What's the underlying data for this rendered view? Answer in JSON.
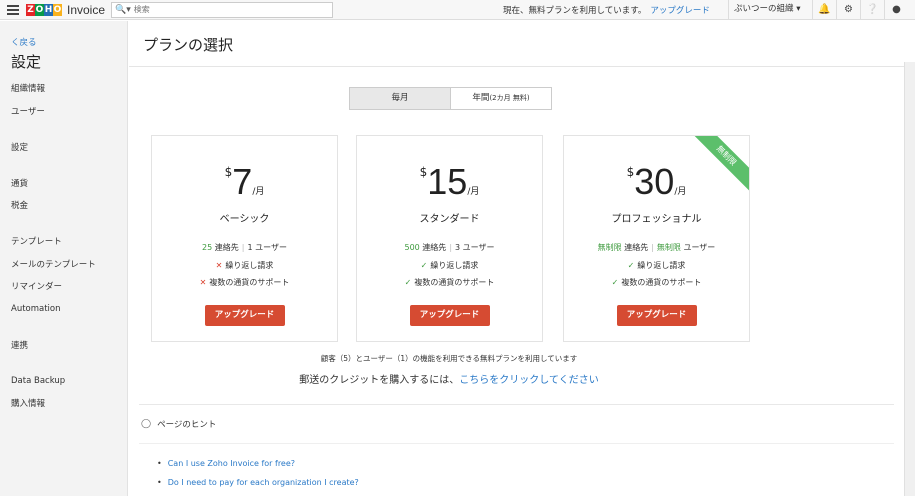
{
  "topbar": {
    "logo_letters": [
      "Z",
      "O",
      "H",
      "O"
    ],
    "logo_colors": [
      "#e42527",
      "#089949",
      "#226db4",
      "#f9b21d"
    ],
    "app_name": "Invoice",
    "search_icon": "search-icon",
    "search_placeholder": "検索",
    "plan_message": "現在、無料プランを利用しています。",
    "upgrade_link": "アップグレード",
    "org_name": "ぷいつーの組織 ▾"
  },
  "sidebar": {
    "back": "く戻る",
    "title": "設定",
    "items": [
      {
        "label": "組織情報"
      },
      {
        "label": "ユーザー"
      },
      {
        "label": "設定"
      },
      {
        "label": "通貨"
      },
      {
        "label": "税金"
      },
      {
        "label": "テンプレート"
      },
      {
        "label": "メールのテンプレート"
      },
      {
        "label": "リマインダー"
      },
      {
        "label": "Automation"
      },
      {
        "label": "連携"
      },
      {
        "label": "Data Backup"
      },
      {
        "label": "購入情報"
      }
    ]
  },
  "main": {
    "title": "プランの選択",
    "billing_toggle": {
      "monthly": "毎月",
      "yearly": "年間",
      "yearly_note": "(2カ月 無料)"
    },
    "plans": [
      {
        "currency": "$",
        "price": "7",
        "per": "/月",
        "name": "ベーシック",
        "contacts_value": "25",
        "contacts_label": "連絡先",
        "users_value": "1",
        "users_label": "ユーザー",
        "features": [
          {
            "text": "繰り返し請求",
            "included": false
          },
          {
            "text": "複数の通貨のサポート",
            "included": false
          }
        ],
        "button": "アップグレード"
      },
      {
        "currency": "$",
        "price": "15",
        "per": "/月",
        "name": "スタンダード",
        "contacts_value": "500",
        "contacts_label": "連絡先",
        "users_value": "3",
        "users_label": "ユーザー",
        "features": [
          {
            "text": "繰り返し請求",
            "included": true
          },
          {
            "text": "複数の通貨のサポート",
            "included": true
          }
        ],
        "button": "アップグレード"
      },
      {
        "currency": "$",
        "price": "30",
        "per": "/月",
        "name": "プロフェッショナル",
        "contacts_value": "無制限",
        "contacts_label": "連絡先",
        "users_value": "無制限",
        "users_label": "ユーザー",
        "features": [
          {
            "text": "繰り返し請求",
            "included": true
          },
          {
            "text": "複数の通貨のサポート",
            "included": true
          }
        ],
        "button": "アップグレード",
        "ribbon": "無制限"
      }
    ],
    "free_plan_note": "顧客（5）とユーザー（1）の機能を利用できる無料プランを利用しています",
    "postal_prefix": "郵送のクレジットを購入するには、",
    "postal_link": "こちらをクリックしてください",
    "hints_title": "ページのヒント",
    "hints": [
      "Can I use Zoho Invoice for free?",
      "Do I need to pay for each organization I create?"
    ]
  }
}
